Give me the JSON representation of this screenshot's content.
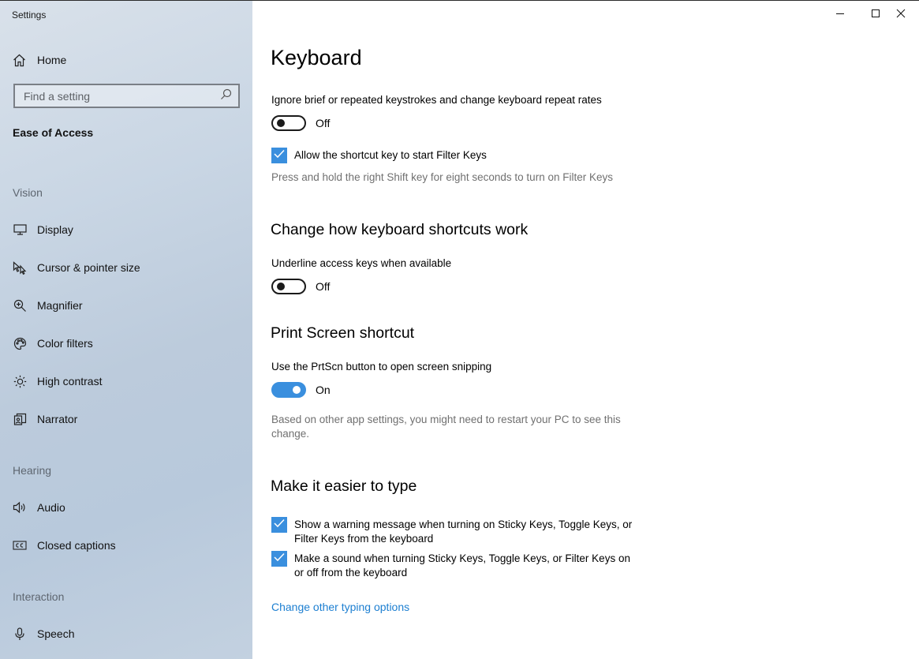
{
  "app": {
    "title": "Settings"
  },
  "sidebar": {
    "home_label": "Home",
    "search_placeholder": "Find a setting",
    "current_section": "Ease of Access",
    "groups": [
      {
        "header": "Vision",
        "items": [
          "Display",
          "Cursor & pointer size",
          "Magnifier",
          "Color filters",
          "High contrast",
          "Narrator"
        ]
      },
      {
        "header": "Hearing",
        "items": [
          "Audio",
          "Closed captions"
        ]
      },
      {
        "header": "Interaction",
        "items": [
          "Speech"
        ]
      }
    ]
  },
  "main": {
    "title": "Keyboard",
    "filter_keys": {
      "label": "Ignore brief or repeated keystrokes and change keyboard repeat rates",
      "toggle_state": "Off",
      "shortcut_checkbox_label": "Allow the shortcut key to start Filter Keys",
      "shortcut_note": "Press and hold the right Shift key for eight seconds to turn on Filter Keys"
    },
    "shortcuts": {
      "heading": "Change how keyboard shortcuts work",
      "label": "Underline access keys when available",
      "toggle_state": "Off"
    },
    "print_screen": {
      "heading": "Print Screen shortcut",
      "label": "Use the PrtScn button to open screen snipping",
      "toggle_state": "On",
      "note": "Based on other app settings, you might need to restart your PC to see this change."
    },
    "typing": {
      "heading": "Make it easier to type",
      "warning_checkbox_label": "Show a warning message when turning on Sticky Keys, Toggle Keys, or Filter Keys from the keyboard",
      "sound_checkbox_label": "Make a sound when turning Sticky Keys, Toggle Keys, or Filter Keys on or off from the keyboard",
      "link": "Change other typing options"
    }
  },
  "colors": {
    "accent": "#3a8fde",
    "link": "#1d7fd1",
    "note_text": "#707070"
  },
  "icons": {
    "home": "home-icon",
    "search": "search-icon",
    "display": "monitor-icon",
    "cursor": "cursor-icon",
    "magnifier": "magnifier-icon",
    "color_filters": "palette-icon",
    "high_contrast": "sun-icon",
    "narrator": "narrator-icon",
    "audio": "speaker-icon",
    "closed_captions": "cc-icon",
    "speech": "microphone-icon"
  }
}
